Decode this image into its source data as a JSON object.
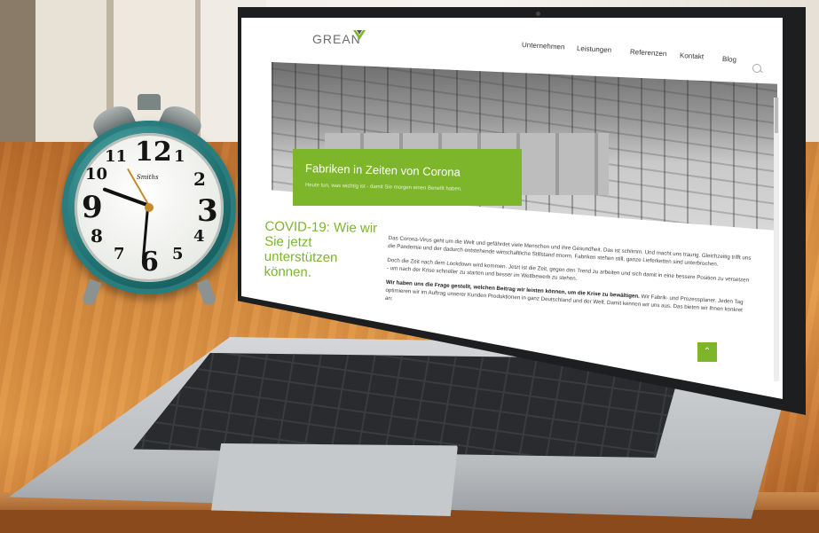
{
  "site": {
    "logo_text": "GREAN",
    "nav": [
      "Unternehmen",
      "Leistungen",
      "Referenzen",
      "Kontakt",
      "Blog"
    ],
    "hero_title": "Fabriken in Zeiten von Corona",
    "hero_subtitle": "Heute tun, was wichtig ist - damit Sie morgen einen Benefit haben.",
    "headline": "COVID-19: Wie wir Sie jetzt unterstützen können.",
    "paragraph_1": "Das Corona-Virus geht um die Welt und gefährdet viele Menschen und ihre Gesundheit. Das ist schlimm. Und macht uns traurig. Gleichzeitig trifft uns die Pandemie und der dadurch entstehende wirtschaftliche Stillstand enorm. Fabriken stehen still, ganze Lieferketten sind unterbrochen.",
    "paragraph_2": "Doch die Zeit nach dem Lockdown wird kommen. Jetzt ist die Zeit, gegen den Trend zu arbeiten und sich damit in eine bessere Position zu versetzen - um nach der Krise schneller zu starten und besser im Wettbewerb zu stehen.",
    "paragraph_3_bold": "Wir haben uns die Frage gestellt, welchen Beitrag wir leisten können, um die Krise zu bewältigen.",
    "paragraph_3": "Wir Fabrik- und Prozessplaner. Jeden Tag optimieren wir im Auftrag unserer Kunden Produktionen in ganz Deutschland und der Welt. Damit kennen wir uns aus. Das bieten wir Ihnen konkret an:",
    "scroll_top_icon": "chevron-up-icon",
    "accent_color": "#7db52b"
  },
  "clock": {
    "numbers": [
      "12",
      "1",
      "2",
      "3",
      "4",
      "5",
      "6",
      "7",
      "8",
      "9",
      "10",
      "11"
    ],
    "brand": "Smiths"
  }
}
